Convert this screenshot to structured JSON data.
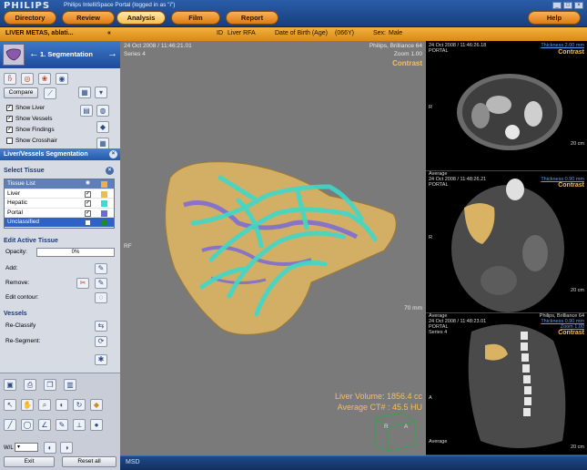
{
  "window": {
    "brand": "PHILIPS",
    "title": "Philips IntelliSpace Portal (logged in as \"i\")"
  },
  "nav": {
    "directory": "Directory",
    "review": "Review",
    "analysis": "Analysis",
    "film": "Film",
    "report": "Report",
    "help": "Help"
  },
  "patient": {
    "name": "LIVER METAS, ablati...",
    "collapse": "«",
    "id_label": "ID",
    "id": "Liver RFA",
    "dob_label": "Date of Birth (Age)",
    "age": "(066Y)",
    "sex_label": "Sex:",
    "sex": "Male"
  },
  "left": {
    "step": "1. Segmentation",
    "compare": "Compare",
    "checks": [
      {
        "label": "Show Liver",
        "checked": true
      },
      {
        "label": "Show Vessels",
        "checked": true
      },
      {
        "label": "Show Findings",
        "checked": true
      },
      {
        "label": "Show Crosshair",
        "checked": false
      }
    ],
    "seg_title": "Liver/Vessels Segmentation",
    "select_tissue": "Select Tissue",
    "tissue_head": "Tissue List",
    "tissues": [
      {
        "name": "Liver",
        "color": "#e8c04a"
      },
      {
        "name": "Hepatic",
        "color": "#3fd8d8"
      },
      {
        "name": "Portal",
        "color": "#6a6ae0"
      },
      {
        "name": "Unclassified",
        "color": "#1f8a2a"
      }
    ],
    "edit_active": "Edit Active Tissue",
    "opacity_label": "Opacity:",
    "opacity_value": "0%",
    "add": "Add:",
    "remove": "Remove:",
    "edit_contour": "Edit contour:",
    "vessels": "Vessels",
    "reclassify": "Re-Classify",
    "resegment": "Re-Segment:",
    "wl_label": "W/L",
    "exit": "Exit",
    "reset_all": "Reset all"
  },
  "main": {
    "date": "24 Oct 2008 / 11:46:21.01",
    "series": "Series 4",
    "device": "Philips, Brilliance 64",
    "zoom": "Zoom 1.00",
    "mode": "Contrast",
    "orient_right": "RF",
    "volume": "Liver Volume: 1856.4 cc",
    "average": "Average CT# : 45.5 HU",
    "scale": "70 mm",
    "cube_r": "R",
    "cube_a": "A"
  },
  "right": [
    {
      "date": "24 Oct 2008 / 11:46:26.18",
      "portal": "PORTAL",
      "thickness": "Thickness 2.00 mm",
      "mode": "Contrast",
      "scale": "20 cm",
      "orient": "R"
    },
    {
      "avg": "Average",
      "date": "24 Oct 2008 / 11:48:26.21",
      "portal": "PORTAL",
      "thickness": "Thickness 0.90 mm",
      "mode": "Contrast",
      "scale": "20 cm",
      "orient": "R"
    },
    {
      "avg": "Average",
      "date": "24 Oct 2008 / 11:48:23.01",
      "portal": "PORTAL",
      "series": "Series 4",
      "device": "Philips, Brilliance 64",
      "thickness": "Thickness 0.90 mm",
      "zoom": "Zoom 1.00",
      "mode": "Contrast",
      "scale": "20 cm",
      "orient": "A",
      "avg2": "Average"
    }
  ],
  "status": {
    "text": "MSD"
  },
  "colors": {
    "liver": "#d9b363",
    "hepatic": "#3fd8c8",
    "portal": "#7b6ad8",
    "accent": "#f6c052"
  }
}
